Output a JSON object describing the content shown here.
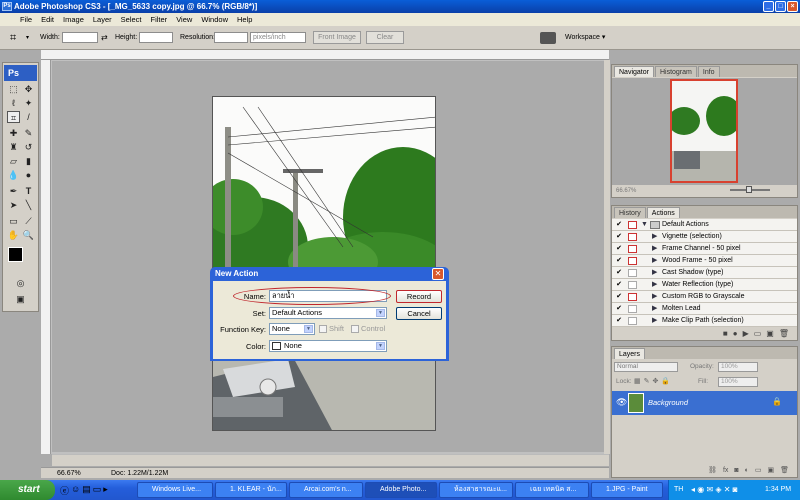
{
  "window": {
    "title": "Adobe Photoshop CS3 - [_MG_5633 copy.jpg @ 66.7% (RGB/8*)]"
  },
  "menu": [
    "File",
    "Edit",
    "Image",
    "Layer",
    "Select",
    "Filter",
    "View",
    "Window",
    "Help"
  ],
  "options_bar": {
    "width_label": "Width:",
    "height_label": "Height:",
    "resolution_label": "Resolution:",
    "units": "pixels/inch",
    "front_image": "Front Image",
    "clear": "Clear",
    "workspace": "Workspace ▾"
  },
  "toolbox": {
    "logo": "Ps"
  },
  "status": {
    "zoom": "66.67%",
    "doc": "Doc: 1.22M/1.22M"
  },
  "navigator_panel": {
    "tabs": [
      "Navigator",
      "Histogram",
      "Info"
    ],
    "zoom": "66.67%"
  },
  "actions_panel": {
    "tabs": [
      "History",
      "Actions"
    ],
    "items": [
      {
        "label": "Default Actions",
        "folder": true
      },
      {
        "label": "Vignette (selection)"
      },
      {
        "label": "Frame Channel - 50 pixel"
      },
      {
        "label": "Wood Frame - 50 pixel"
      },
      {
        "label": "Cast Shadow (type)"
      },
      {
        "label": "Water Reflection (type)"
      },
      {
        "label": "Custom RGB to Grayscale"
      },
      {
        "label": "Molten Lead"
      },
      {
        "label": "Make Clip Path (selection)"
      }
    ]
  },
  "layers_panel": {
    "tabs": [
      "Layers"
    ],
    "blend": "Normal",
    "opacity_label": "Opacity:",
    "opacity": "100%",
    "lock_label": "Lock:",
    "fill_label": "Fill:",
    "fill": "100%",
    "layer_name": "Background"
  },
  "dialog": {
    "title": "New Action",
    "name_label": "Name:",
    "name_value": "ลายน้ำ",
    "set_label": "Set:",
    "set_value": "Default Actions",
    "function_key_label": "Function Key:",
    "function_key_value": "None",
    "shift_label": "Shift",
    "control_label": "Control",
    "color_label": "Color:",
    "color_value": "None",
    "record": "Record",
    "cancel": "Cancel"
  },
  "taskbar": {
    "start": "start",
    "tasks": [
      "Windows Live...",
      "1. KLEAR - นัก...",
      "Arcai.com's n...",
      "Adobe Photo...",
      "ห้องสาธารณะแ...",
      "เฉย เทคนิค ส...",
      "1.JPG - Paint"
    ],
    "lang": "TH",
    "clock": "1:34 PM"
  },
  "colors": {
    "title_blue": "#0a4fc8",
    "dialog_blue": "#2c63d8",
    "layer_selected": "#3a6fd1",
    "highlight_red": "#c0272d"
  }
}
